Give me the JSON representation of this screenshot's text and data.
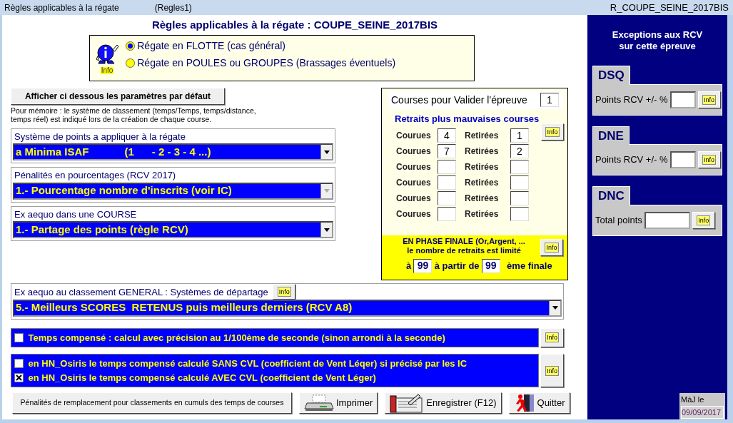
{
  "window": {
    "title": "Règles applicables à la régate",
    "form": "(Regles1)",
    "regatta_id": "R_COUPE_SEINE_2017BIS"
  },
  "heading": "Règles applicables à la régate : COUPE_SEINE_2017BIS",
  "mode_box": {
    "mascot_label": "Info",
    "options": [
      {
        "label": "Régate en FLOTTE (cas général)",
        "selected": true
      },
      {
        "label": "Régate en POULES ou GROUPES (Brassages éventuels)",
        "selected": false
      }
    ]
  },
  "defaults_button": "Afficher ci dessous les paramètres par défaut",
  "note": "Pour mémoire : le système de classement (temps/Temps, temps/distance, temps réel) est indiqué lors de la création de chaque course.",
  "selects": [
    {
      "label": "Système de points a appliquer à la régate",
      "value": "a Minima ISAF            (1      - 2 - 3 - 4 ...)",
      "disabled": false
    },
    {
      "label": "Pénalités en pourcentages (RCV 2017)",
      "value": "1.- Pourcentage nombre d'inscrits (voir IC)",
      "disabled": true
    },
    {
      "label": "Ex aequo dans une COURSE",
      "value": "1.- Partage des points (règle RCV)",
      "disabled": false
    }
  ],
  "courses": {
    "validate_label": "Courses pour Valider l'épreuve",
    "validate_value": "1",
    "discards_title": "Retraits plus mauvaises courses",
    "info": "Info",
    "rows": [
      {
        "races_label": "Courues",
        "races": "4",
        "discards_label": "Retirées",
        "discards": "1"
      },
      {
        "races_label": "Courues",
        "races": "7",
        "discards_label": "Retirées",
        "discards": "2"
      },
      {
        "races_label": "Courues",
        "discards_label": "Retirées"
      },
      {
        "races_label": "Courues",
        "discards_label": "Retirées"
      },
      {
        "races_label": "Courues",
        "discards_label": "Retirées"
      },
      {
        "races_label": "Courues",
        "discards_label": "Retirées"
      }
    ],
    "final": {
      "line1": "EN PHASE FINALE (Or,Argent, ...",
      "line2": "le nombre de retraits est limité",
      "info": "Info",
      "prefix": "à",
      "limit": "99",
      "middle": "à partir de",
      "from": "99",
      "suffix": "ème finale"
    }
  },
  "tiebreak": {
    "label": "Ex aequo au classement GENERAL : Systèmes de départage",
    "info": "Info",
    "value": "5.- Meilleurs SCORES  RETENUS puis meilleurs derniers (RCV A8)"
  },
  "option_groups": [
    {
      "info": "Info",
      "items": [
        {
          "label": "Temps compensé :  calcul avec précision au 1/100ème de seconde (sinon arrondi à la seconde)",
          "checked": false
        }
      ]
    },
    {
      "info": "Info",
      "items": [
        {
          "label": "en HN_Osiris le temps compensé calculé SANS CVL (coefficient de Vent Léqer) si précisé par les IC",
          "checked": false
        },
        {
          "label": "en HN_Osiris le temps compensé calculé AVEC CVL (coefficient de Vent Léger)",
          "checked": true
        }
      ]
    }
  ],
  "buttons": [
    {
      "label": "Pénalités de remplacement pour classements  en cumuls des temps de courses",
      "kind": "plain"
    },
    {
      "label": "Imprimer",
      "kind": "print"
    },
    {
      "label": "Enregistrer (F12)",
      "kind": "save"
    },
    {
      "label": "Quitter",
      "kind": "quit"
    }
  ],
  "exceptions": {
    "title_lines": [
      "Exceptions aux RCV",
      "sur cette épreuve"
    ],
    "groups": [
      {
        "code": "DSQ",
        "label": "Points RCV +/- %",
        "info": "Info"
      },
      {
        "code": "DNE",
        "label": "Points RCV +/- %",
        "info": "Info"
      },
      {
        "code": "DNC",
        "label": "Total points",
        "info": "Info"
      }
    ]
  },
  "updated": {
    "label": "MàJ le",
    "date": "09/09/2017"
  }
}
